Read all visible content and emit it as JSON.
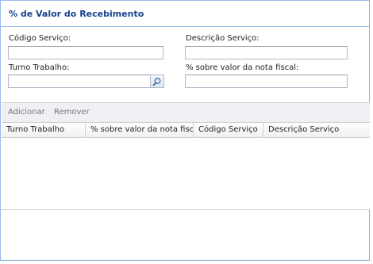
{
  "panel": {
    "title": "% de Valor do Recebimento"
  },
  "form": {
    "codigo_label": "Código Serviço:",
    "codigo_value": "",
    "descricao_label": "Descrição Serviço:",
    "descricao_value": "",
    "turno_label": "Turno Trabalho:",
    "turno_value": "",
    "percent_label": "% sobre valor da nota fiscal:",
    "percent_value": ""
  },
  "toolbar": {
    "add_label": "Adicionar",
    "remove_label": "Remover"
  },
  "grid": {
    "columns": [
      {
        "label": "Turno Trabalho"
      },
      {
        "label": "% sobre valor da nota fiscal"
      },
      {
        "label": "Código Serviço"
      },
      {
        "label": "Descrição Serviço"
      }
    ],
    "rows": []
  },
  "icons": {
    "turno_trigger": "search-icon"
  },
  "colors": {
    "border": "#99bbe8",
    "title": "#15428b"
  }
}
